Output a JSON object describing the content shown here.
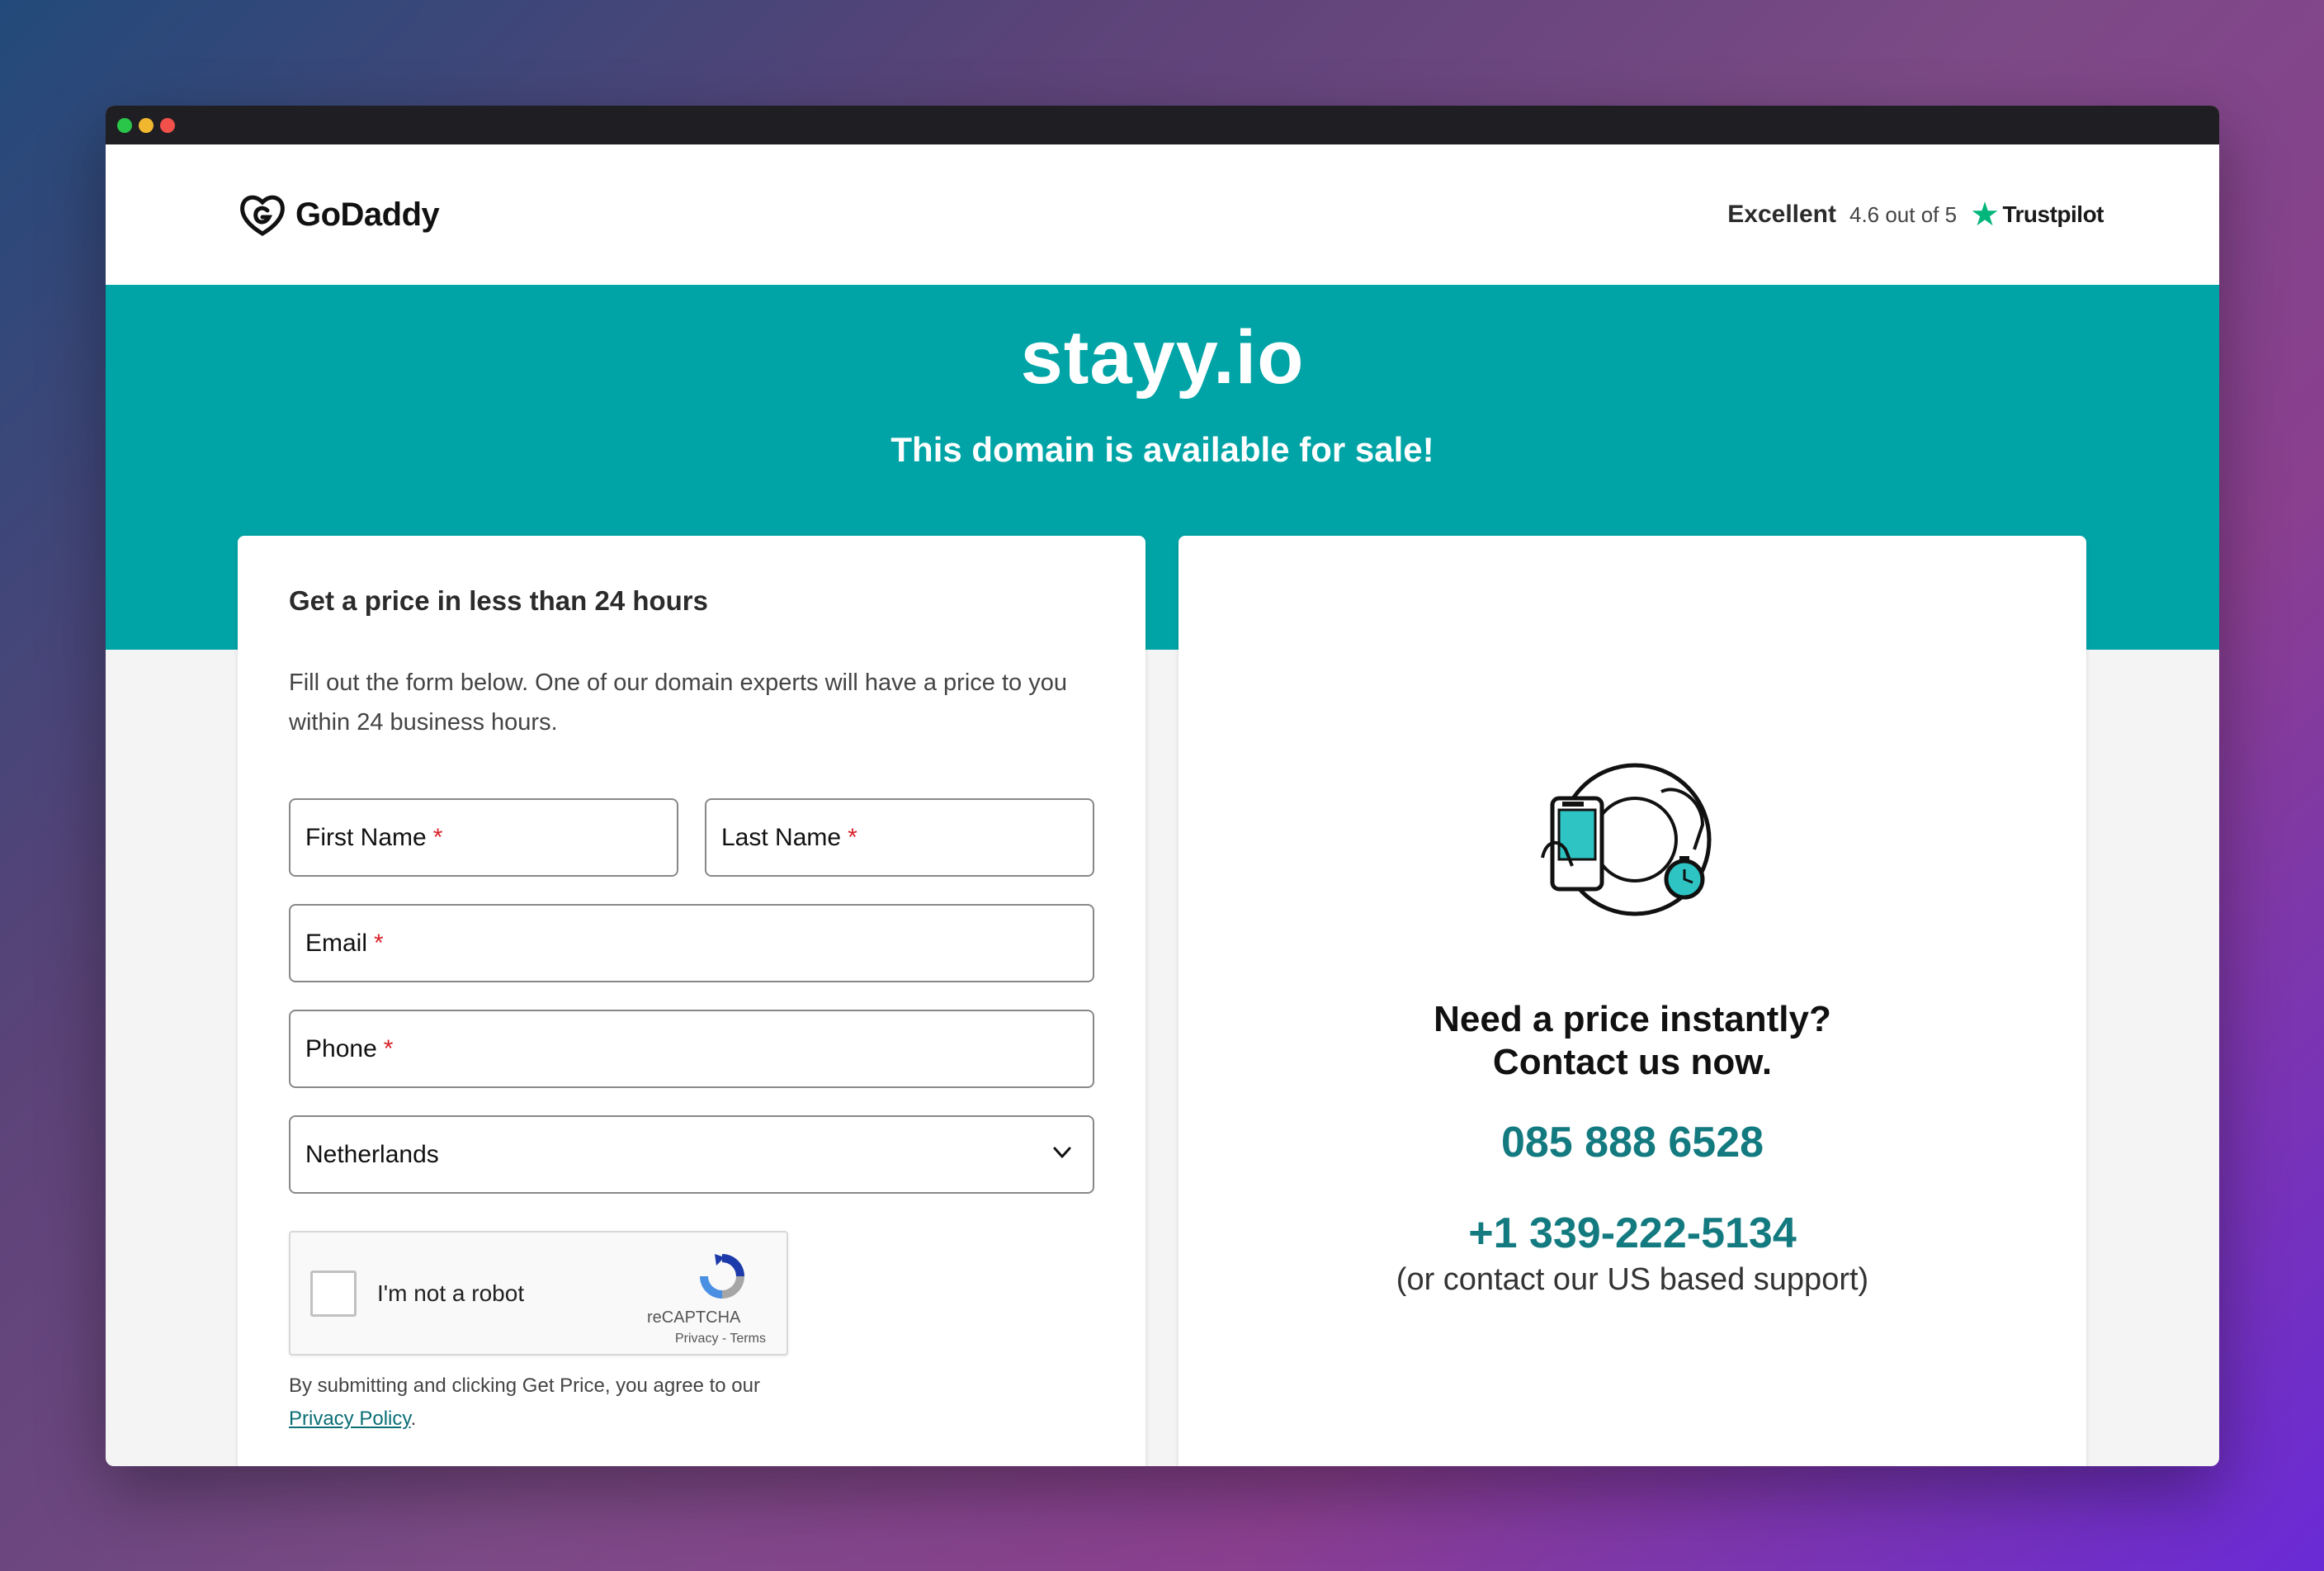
{
  "header": {
    "logo_text": "GoDaddy",
    "rating_label": "Excellent",
    "rating_score": "4.6 out of 5",
    "trustpilot_label": "Trustpilot"
  },
  "hero": {
    "domain": "stayy.io",
    "subtitle": "This domain is available for sale!"
  },
  "form": {
    "title": "Get a price in less than 24 hours",
    "description": "Fill out the form below. One of our domain experts will have a price to you within 24 business hours.",
    "first_name_label": "First Name",
    "last_name_label": "Last Name",
    "email_label": "Email",
    "phone_label": "Phone",
    "required_marker": "*",
    "country_selected": "Netherlands",
    "captcha_label": "I'm not a robot",
    "captcha_brand": "reCAPTCHA",
    "captcha_links": "Privacy - Terms",
    "disclaimer": "By submitting and clicking Get Price, you agree to our",
    "privacy_link": "Privacy Policy",
    "disclaimer_end": "."
  },
  "contact": {
    "cta_line1": "Need a price instantly?",
    "cta_line2": "Contact us now.",
    "phone_local": "085 888 6528",
    "phone_us": "+1 339-222-5134",
    "us_note": "(or contact our US based support)"
  },
  "colors": {
    "teal": "#00a4a6",
    "phone_teal": "#137a80",
    "required_red": "#d9222a",
    "trustpilot_green": "#00b67a"
  }
}
